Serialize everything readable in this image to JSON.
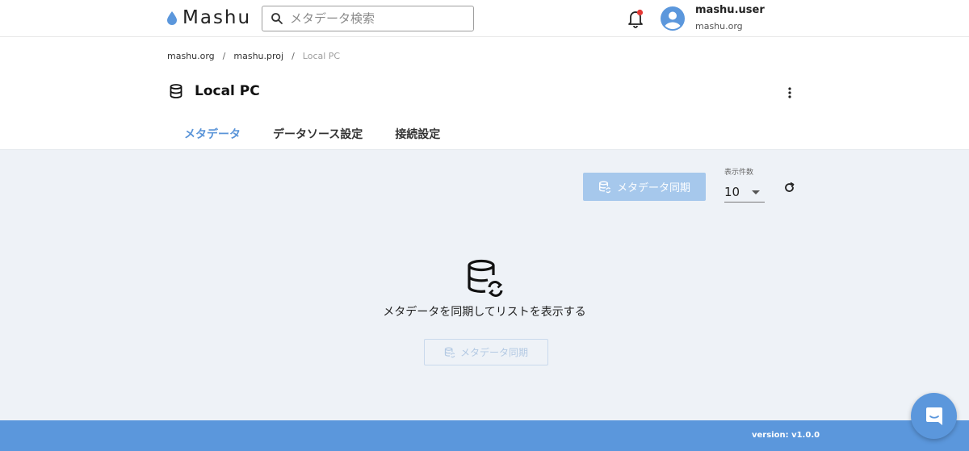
{
  "header": {
    "logo_text": "Mashu",
    "search_placeholder": "メタデータ検索",
    "user_name": "mashu.user",
    "user_org": "mashu.org",
    "brand_color": "#5b97dc",
    "notification_dot_color": "#e53935"
  },
  "breadcrumb": {
    "items": [
      "mashu.org",
      "mashu.proj",
      "Local PC"
    ],
    "separator": "/"
  },
  "page": {
    "title": "Local PC",
    "title_icon": "database-icon"
  },
  "tabs": [
    {
      "label": "メタデータ",
      "active": true
    },
    {
      "label": "データソース設定",
      "active": false
    },
    {
      "label": "接続設定",
      "active": false
    }
  ],
  "toolbar": {
    "sync_button_label": "メタデータ同期",
    "count_label": "表示件数",
    "count_value": "10"
  },
  "empty_state": {
    "message": "メタデータを同期してリストを表示する",
    "button_label": "メタデータ同期"
  },
  "footer": {
    "version": "version: v1.0.0"
  }
}
